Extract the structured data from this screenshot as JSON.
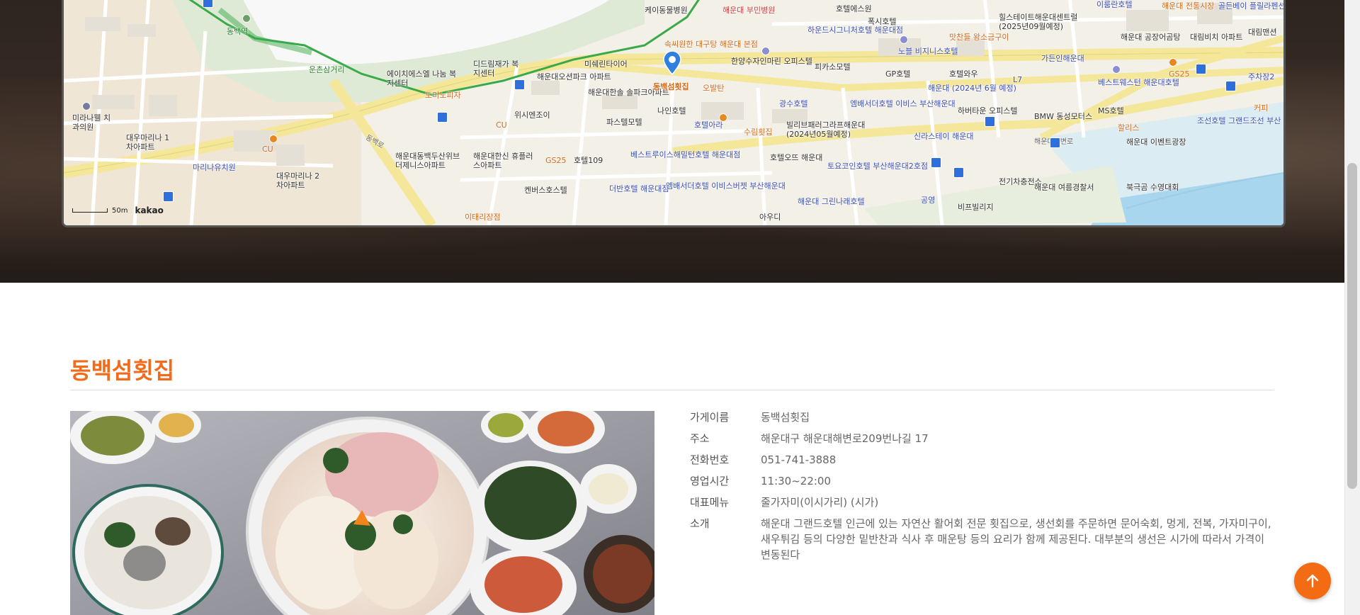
{
  "map": {
    "scale_label": "50m",
    "logo": "kakao",
    "marker_label": "동백섬횟집",
    "labels": [
      {
        "t": "케이동물병원",
        "c": ""
      },
      {
        "t": "해운대 부민병원",
        "c": "red"
      },
      {
        "t": "호텔에스원",
        "c": ""
      },
      {
        "t": "폭시호텔",
        "c": ""
      },
      {
        "t": "힐스테이트해운대센트럴 (2025년09월예정)",
        "c": ""
      },
      {
        "t": "해운대 공장어곰탕",
        "c": ""
      },
      {
        "t": "대림비치 아파트",
        "c": ""
      },
      {
        "t": "골든베이 플릴라펜션",
        "c": "blue"
      },
      {
        "t": "이룸란호텔",
        "c": "blue"
      },
      {
        "t": "해운대 전통시장",
        "c": "orange"
      },
      {
        "t": "대림맨션",
        "c": ""
      },
      {
        "t": "하운드시그니처호텔 해운대점",
        "c": "blue"
      },
      {
        "t": "맛찬들 왕소금구이",
        "c": "orange"
      },
      {
        "t": "노블 비지니스호텔",
        "c": "blue"
      },
      {
        "t": "속씨원한 대구탕 해운대 본점",
        "c": "orange"
      },
      {
        "t": "한양수자인마린 오피스텔",
        "c": ""
      },
      {
        "t": "피카소모텔",
        "c": ""
      },
      {
        "t": "GP호텔",
        "c": ""
      },
      {
        "t": "호텔와우",
        "c": ""
      },
      {
        "t": "가든인해운대",
        "c": "blue"
      },
      {
        "t": "베스트웨스턴 해운대호텔",
        "c": "blue"
      },
      {
        "t": "GS25",
        "c": "orange"
      },
      {
        "t": "주차장2",
        "c": "blue"
      },
      {
        "t": "커피",
        "c": "orange"
      },
      {
        "t": "미쉐린타이어",
        "c": ""
      },
      {
        "t": "해운대오션파크 아파트",
        "c": ""
      },
      {
        "t": "해운대한솔 솔파크아파트",
        "c": ""
      },
      {
        "t": "오발탄",
        "c": "orange"
      },
      {
        "t": "해운대 (2024년 6월 예정)",
        "c": "blue"
      },
      {
        "t": "L7",
        "c": "blue"
      },
      {
        "t": "엠배서더호텔 이비스 부산해운대",
        "c": "blue"
      },
      {
        "t": "나인호텔",
        "c": ""
      },
      {
        "t": "호텔아라",
        "c": "blue"
      },
      {
        "t": "광수호텔",
        "c": "blue"
      },
      {
        "t": "하버타운 오피스텔",
        "c": ""
      },
      {
        "t": "BMW 동성모터스",
        "c": ""
      },
      {
        "t": "MS호텔",
        "c": ""
      },
      {
        "t": "할리스",
        "c": "orange"
      },
      {
        "t": "조선호텔 그랜드조선 부산",
        "c": "blue"
      },
      {
        "t": "파스텔모텔",
        "c": ""
      },
      {
        "t": "수림횟집",
        "c": "orange"
      },
      {
        "t": "빌리브패러그라프해운대 (2024년05월예정)",
        "c": ""
      },
      {
        "t": "신라스테이 해운대",
        "c": "blue"
      },
      {
        "t": "해운대해변로",
        "c": "num"
      },
      {
        "t": "해운대 이벤트광장",
        "c": ""
      },
      {
        "t": "베스트루이스해밀턴호텔 해운대점",
        "c": "blue"
      },
      {
        "t": "호텔오뜨 해운대",
        "c": ""
      },
      {
        "t": "토요코인호텔 부산해운대2호점",
        "c": "blue"
      },
      {
        "t": "전기차충전소",
        "c": ""
      },
      {
        "t": "북극곰 수영대회",
        "c": ""
      },
      {
        "t": "해운대 여름경찰서",
        "c": ""
      },
      {
        "t": "더반호텔 해운대점",
        "c": "blue"
      },
      {
        "t": "엠배서더호텔 이비스버젯 부산해운대",
        "c": "blue"
      },
      {
        "t": "해운대 그린나래호텔",
        "c": "blue"
      },
      {
        "t": "공영",
        "c": "blue"
      },
      {
        "t": "비프빌리지",
        "c": ""
      },
      {
        "t": "아우디",
        "c": ""
      },
      {
        "t": "켄버스호스텔",
        "c": ""
      },
      {
        "t": "호텔109",
        "c": ""
      },
      {
        "t": "GS25",
        "c": "orange"
      },
      {
        "t": "해운대한신 휴플러스아파트",
        "c": ""
      },
      {
        "t": "해운대동백두산위브 더제니스아파트",
        "c": ""
      },
      {
        "t": "CU",
        "c": "orange"
      },
      {
        "t": "위시엔조이",
        "c": ""
      },
      {
        "t": "도미노피자",
        "c": "orange"
      },
      {
        "t": "디드림재가 복지센터",
        "c": ""
      },
      {
        "t": "에이치에스엘 나눔 복지센터",
        "c": ""
      },
      {
        "t": "운촌삼거리",
        "c": "green"
      },
      {
        "t": "동백역",
        "c": "green"
      },
      {
        "t": "미라나웰 치과의원",
        "c": ""
      },
      {
        "t": "대우마리나 1차아파트",
        "c": ""
      },
      {
        "t": "마리나유치원",
        "c": "blue"
      },
      {
        "t": "대우마리나 2차아파트",
        "c": ""
      },
      {
        "t": "CU",
        "c": "orange"
      },
      {
        "t": "이태리장점",
        "c": "orange"
      },
      {
        "t": "동백로",
        "c": "num"
      }
    ]
  },
  "restaurant": {
    "name": "동백섬횟집",
    "fields": [
      {
        "key": "가게이름",
        "value": "동백섬횟집"
      },
      {
        "key": "주소",
        "value": "해운대구 해운대해변로209번나길 17"
      },
      {
        "key": "전화번호",
        "value": "051-741-3888"
      },
      {
        "key": "영업시간",
        "value": "11:30~22:00"
      },
      {
        "key": "대표메뉴",
        "value": "줄가자미(이시가리) (시가)"
      },
      {
        "key": "소개",
        "value": "해운대 그랜드호텔 인근에 있는 자연산 활어회 전문 횟집으로, 생선회를 주문하면 문어숙회, 멍게, 전복, 가자미구이, 새우튀김 등의 다양한 밑반찬과 식사 후 매운탕 등의 요리가 함께 제공된다. 대부분의 생선은 시가에 따라서 가격이 변동된다"
      }
    ]
  },
  "scroll_top": {
    "icon": "arrow-up-icon"
  }
}
